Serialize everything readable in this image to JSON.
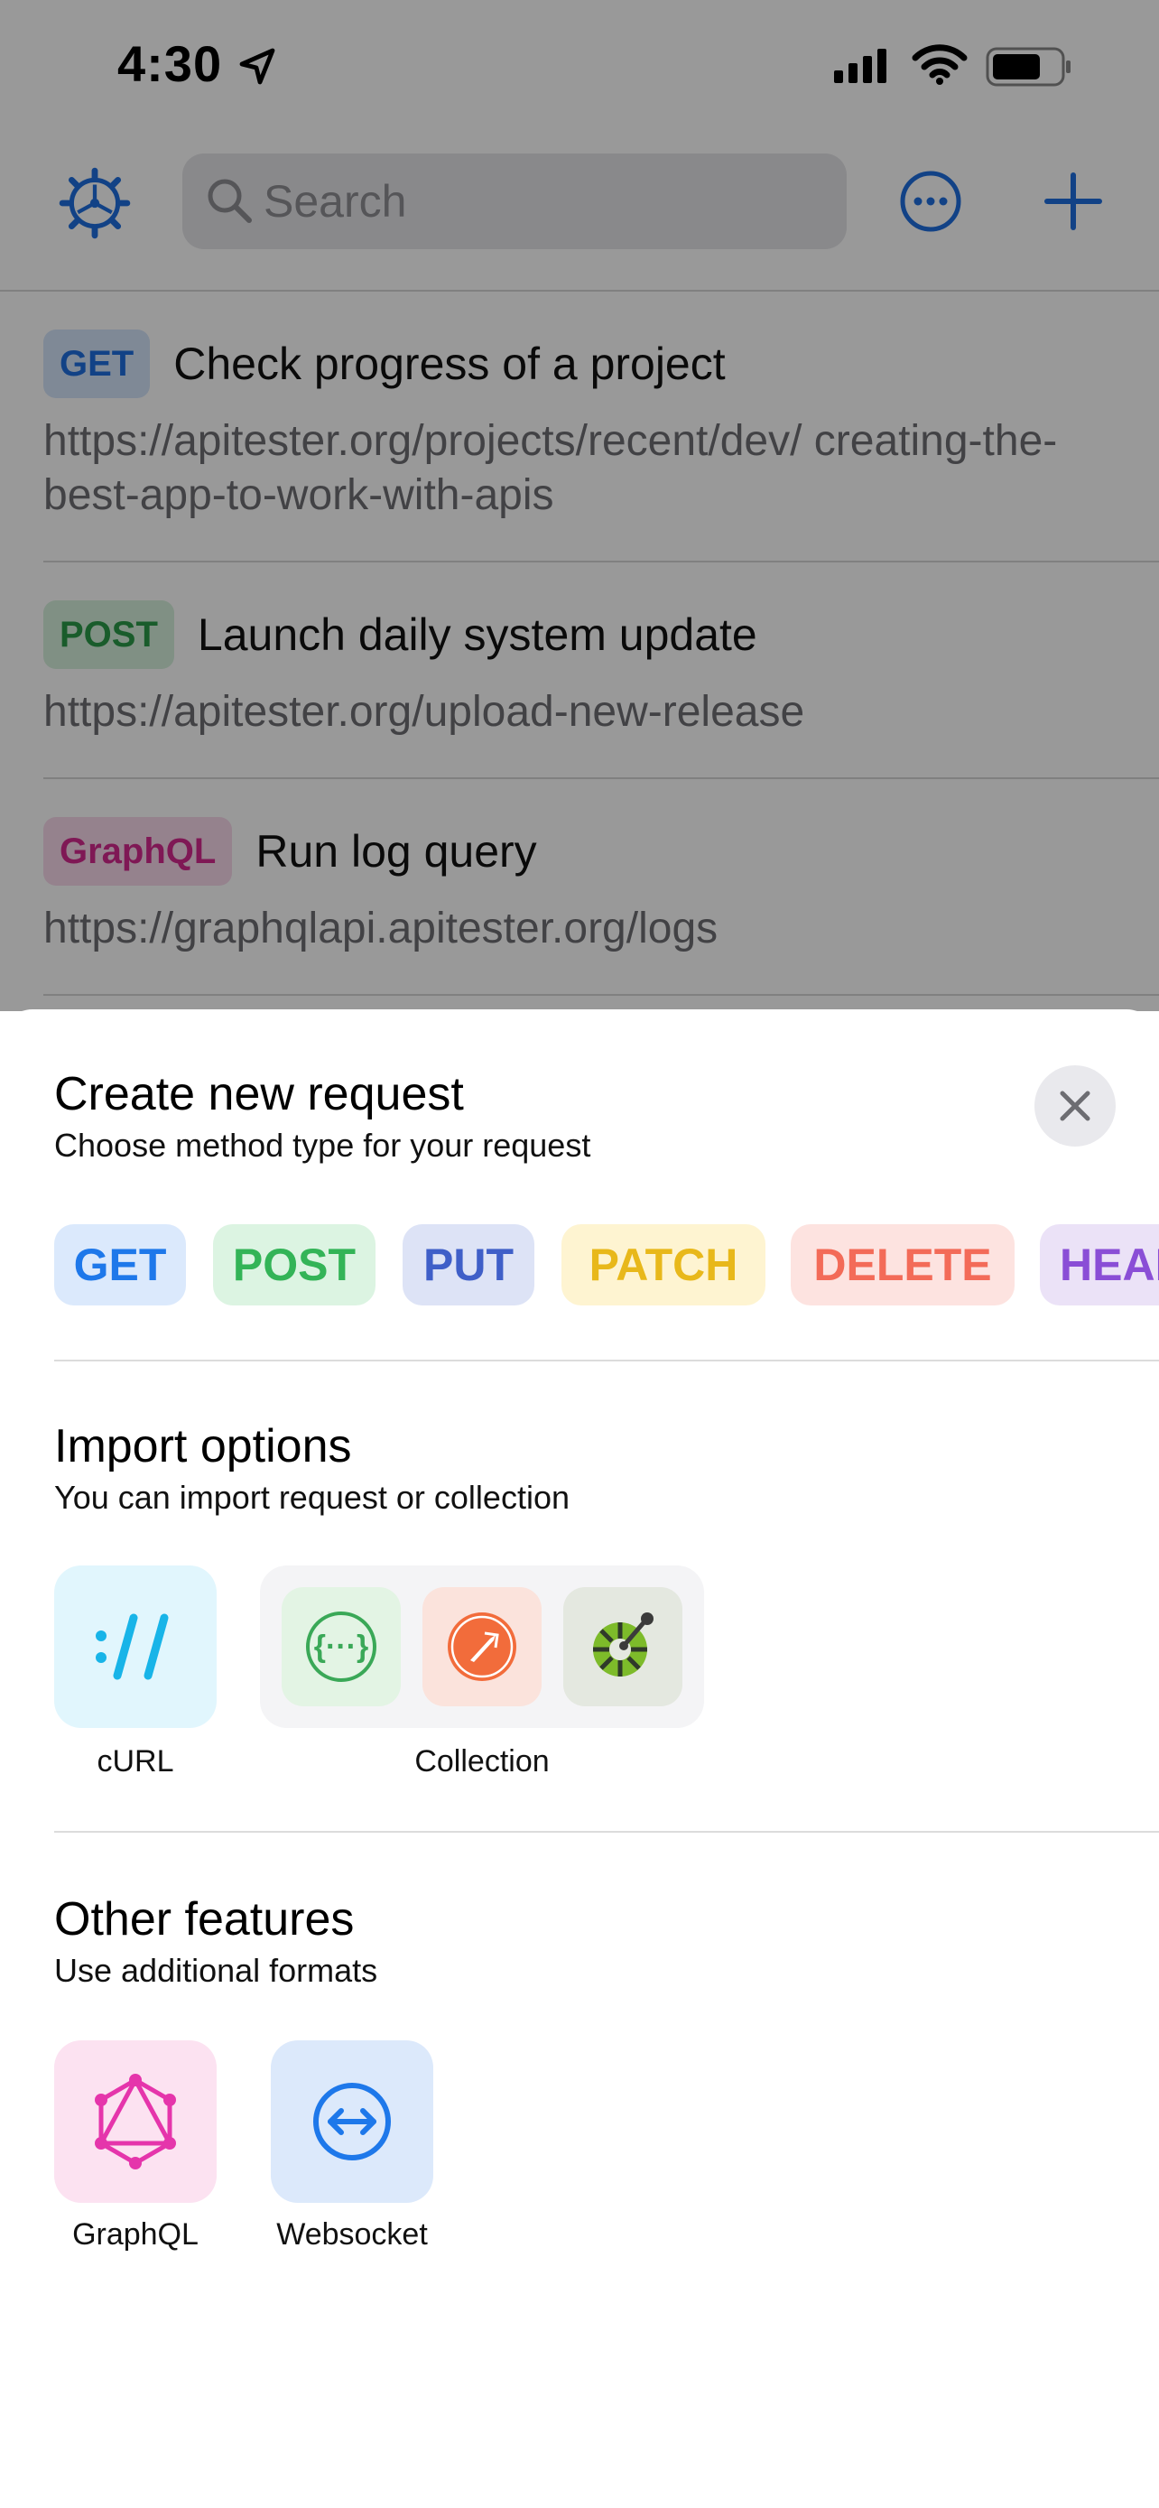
{
  "status_bar": {
    "time": "4:30"
  },
  "toolbar": {
    "search_placeholder": "Search"
  },
  "requests": [
    {
      "method": "GET",
      "title": "Check progress of a project",
      "url": "https://apitester.org/projects/recent/dev/ creating-the-best-app-to-work-with-apis"
    },
    {
      "method": "POST",
      "title": "Launch daily system update",
      "url": "https://apitester.org/upload-new-release"
    },
    {
      "method": "GraphQL",
      "title": "Run log query",
      "url": "https://graphqlapi.apitester.org/logs"
    }
  ],
  "sheet": {
    "title": "Create new request",
    "subtitle": "Choose method type for your request",
    "methods": [
      "GET",
      "POST",
      "PUT",
      "PATCH",
      "DELETE",
      "HEAD"
    ],
    "import": {
      "title": "Import options",
      "subtitle": "You can import request or collection",
      "curl_label": "cURL",
      "collection_label": "Collection"
    },
    "other": {
      "title": "Other features",
      "subtitle": "Use additional formats",
      "graphql_label": "GraphQL",
      "websocket_label": "Websocket"
    }
  },
  "colors": {
    "accent": "#1e6fe0",
    "get": "#1e78ea",
    "post": "#33b457",
    "put": "#3f5fc8",
    "patch": "#e8b81a",
    "delete": "#f36b58",
    "head": "#8a4ed6",
    "graphql": "#d4288e"
  },
  "icons": [
    "location-arrow-icon",
    "signal-icon",
    "wifi-icon",
    "battery-icon",
    "gear-icon",
    "search-icon",
    "ellipsis-circle-icon",
    "plus-icon",
    "close-icon",
    "curl-icon",
    "openapi-icon",
    "postman-icon",
    "insomnia-icon",
    "graphql-icon",
    "websocket-icon"
  ]
}
